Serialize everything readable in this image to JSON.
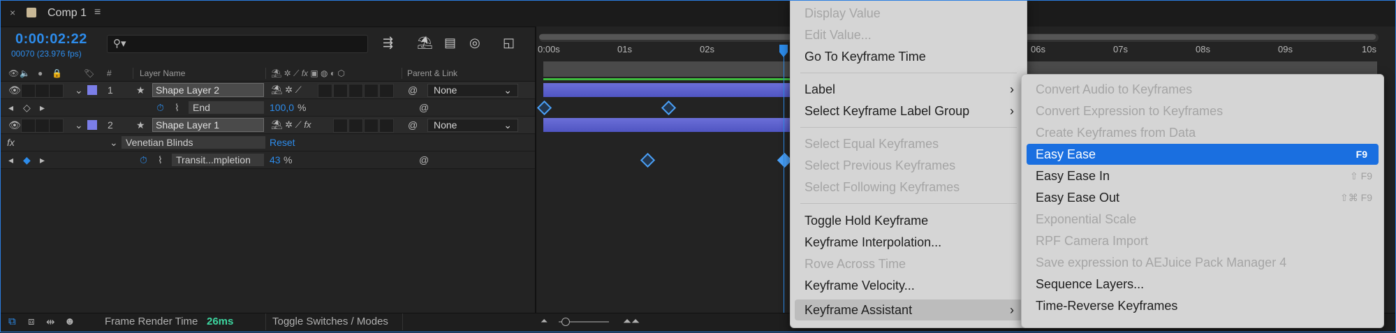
{
  "tab": {
    "close": "×",
    "title": "Comp 1",
    "menu": "≡"
  },
  "header": {
    "timecode": "0:00:02:22",
    "frames": "00070 (23.976 fps)",
    "search_icon": "⚲▾"
  },
  "columns": {
    "layer_name": "Layer Name",
    "parent_link": "Parent & Link",
    "number_hash": "#"
  },
  "layers": [
    {
      "index": "1",
      "name": "Shape Layer 2",
      "parent": "None",
      "color": "#7b7ee8"
    },
    {
      "index": "2",
      "name": "Shape Layer 1",
      "parent": "None",
      "color": "#7b7ee8"
    }
  ],
  "props": {
    "end_label": "End",
    "end_value": "100,0",
    "end_unit": "%",
    "effect_label": "Venetian Blinds",
    "effect_reset": "Reset",
    "trans_label": "Transit...mpletion",
    "trans_value": "43",
    "trans_unit": "%",
    "fx": "fx"
  },
  "ruler": {
    "labels": [
      "0:00s",
      "01s",
      "02s",
      "06s",
      "07s",
      "08s",
      "09s",
      "10s"
    ]
  },
  "bottom": {
    "render_label": "Frame Render Time",
    "render_value": "26ms",
    "toggle": "Toggle Switches / Modes"
  },
  "menu": {
    "items": [
      {
        "label": "Display Value",
        "disabled": true
      },
      {
        "label": "Edit Value...",
        "disabled": true
      },
      {
        "label": "Go To Keyframe Time",
        "disabled": false
      },
      {
        "label": "Label",
        "disabled": false,
        "arrow": "›"
      },
      {
        "label": "Select Keyframe Label Group",
        "disabled": false,
        "arrow": "›"
      },
      {
        "label": "Select Equal Keyframes",
        "disabled": true
      },
      {
        "label": "Select Previous Keyframes",
        "disabled": true
      },
      {
        "label": "Select Following Keyframes",
        "disabled": true
      },
      {
        "label": "Toggle Hold Keyframe",
        "disabled": false
      },
      {
        "label": "Keyframe Interpolation...",
        "disabled": false
      },
      {
        "label": "Rove Across Time",
        "disabled": true
      },
      {
        "label": "Keyframe Velocity...",
        "disabled": false
      },
      {
        "label": "Keyframe Assistant",
        "disabled": false,
        "arrow": "›"
      }
    ]
  },
  "submenu": {
    "items": [
      {
        "label": "Convert Audio to Keyframes",
        "disabled": true,
        "shortcut": ""
      },
      {
        "label": "Convert Expression to Keyframes",
        "disabled": true,
        "shortcut": ""
      },
      {
        "label": "Create Keyframes from Data",
        "disabled": true,
        "shortcut": ""
      },
      {
        "label": "Easy Ease",
        "disabled": false,
        "shortcut": "F9"
      },
      {
        "label": "Easy Ease In",
        "disabled": false,
        "shortcut": "⇧ F9"
      },
      {
        "label": "Easy Ease Out",
        "disabled": false,
        "shortcut": "⇧⌘ F9"
      },
      {
        "label": "Exponential Scale",
        "disabled": true,
        "shortcut": ""
      },
      {
        "label": "RPF Camera Import",
        "disabled": true,
        "shortcut": ""
      },
      {
        "label": "Save expression to AEJuice Pack Manager 4",
        "disabled": true,
        "shortcut": ""
      },
      {
        "label": "Sequence Layers...",
        "disabled": false,
        "shortcut": ""
      },
      {
        "label": "Time-Reverse Keyframes",
        "disabled": false,
        "shortcut": ""
      }
    ]
  },
  "colors": {
    "accent": "#2d8ceb",
    "highlight": "#1a6fe0",
    "layer_bar": "#5a5ecd",
    "render_value": "#3dd6a0"
  }
}
